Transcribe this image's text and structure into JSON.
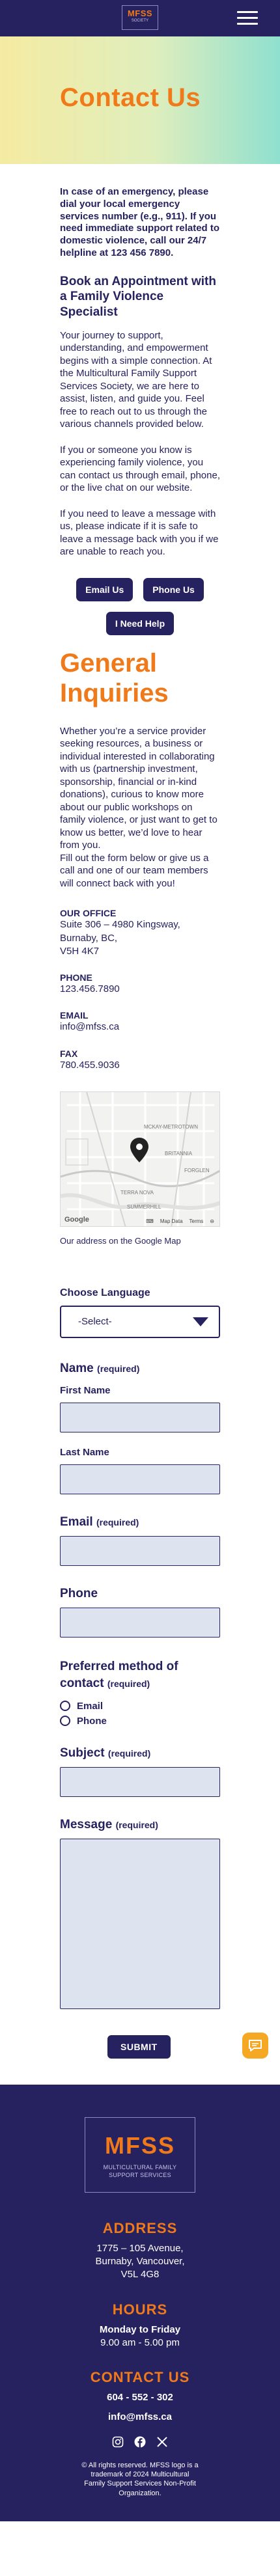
{
  "header": {
    "logo_title": "MFSS",
    "logo_sub": "SOCIETY"
  },
  "hero": {
    "title": "Contact Us"
  },
  "emergency": "In case of an emergency, please dial your local emergency services number (e.g., 911). If you need immediate support related to domestic violence, call our 24/7 helpline at 123 456 7890.",
  "appointment": {
    "heading": "Book an Appointment with a Family Violence Specialist",
    "p1": "Your journey to support, understanding, and empowerment begins with a simple connection. At the Multicultural Family Support Services Society, we are here to assist, listen, and guide you. Feel free to reach out to us through the various channels provided below.",
    "p2": "If you or someone you know is experiencing family violence, you can contact us through email, phone, or the live chat on our website.",
    "p3": "If you need to leave a message with us, please indicate if it is safe to leave a message back with you if we are unable to reach you."
  },
  "buttons": {
    "email": "Email Us",
    "phone": "Phone Us",
    "help": "I Need Help"
  },
  "general": {
    "heading_1": "General",
    "heading_2": "Inquiries",
    "text_1": "Whether you’re a service provider seeking resources, a business or individual interested in collaborating with us (partnership investment, sponsorship, financial or in-kind donations), curious to know more about our public workshops on family violence, or just want to get to know us better, we’d love to hear from you.",
    "text_2": "Fill out the form below or give us a call and one of our team members will connect back with you!"
  },
  "office": {
    "label": "OUR OFFICE",
    "line1": "Suite 306 – 4980 Kingsway,",
    "line2": "Burnaby, BC,",
    "line3": "V5H 4K7"
  },
  "phone": {
    "label": "PHONE",
    "value": "123.456.7890"
  },
  "email": {
    "label": "EMAIL",
    "value": "info@mfss.ca"
  },
  "fax": {
    "label": "FAX",
    "value": "780.455.9036"
  },
  "map": {
    "labels": [
      "MCKAY-METROTOWN",
      "BRITANNIA",
      "FORGLEN",
      "TERRA NOVA",
      "SUMMERHILL"
    ],
    "google": "Google",
    "map_data": "Map Data",
    "terms": "Terms",
    "caption": "Our address on the Google Map"
  },
  "form": {
    "language_label": "Choose Language",
    "language_value": "-Select-",
    "name_label": "Name",
    "name_req": "(required)",
    "first_name": "First Name",
    "last_name": "Last Name",
    "email_label": "Email",
    "email_req": "(required)",
    "phone_label": "Phone",
    "preferred_label": "Preferred method of contact",
    "preferred_req": "(required)",
    "option_email": "Email",
    "option_phone": "Phone",
    "subject_label": "Subject",
    "subject_req": "(required)",
    "message_label": "Message",
    "message_req": "(required)",
    "submit": "SUBMIT"
  },
  "footer": {
    "logo_title": "MFSS",
    "logo_sub1": "MULTICULTURAL FAMILY",
    "logo_sub2": "SUPPORT SERVICES",
    "address_h": "ADDRESS",
    "address_1": "1775 – 105 Avenue,",
    "address_2": "Burnaby, Vancouver,",
    "address_3": "V5L 4G8",
    "hours_h": "HOURS",
    "hours_1": "Monday to Friday",
    "hours_2": "9.00 am - 5.00 pm",
    "contact_h": "CONTACT US",
    "contact_phone": "604 - 552 - 302",
    "contact_email": "info@mfss.ca",
    "copyright": "© All rights reserved. MFSS logo is a trademark of 2024 Multicultural Family Support Services Non-Profit Organization."
  },
  "colors": {
    "navy": "#26215f",
    "orange": "#f07a1a",
    "chat": "#f4a823"
  }
}
